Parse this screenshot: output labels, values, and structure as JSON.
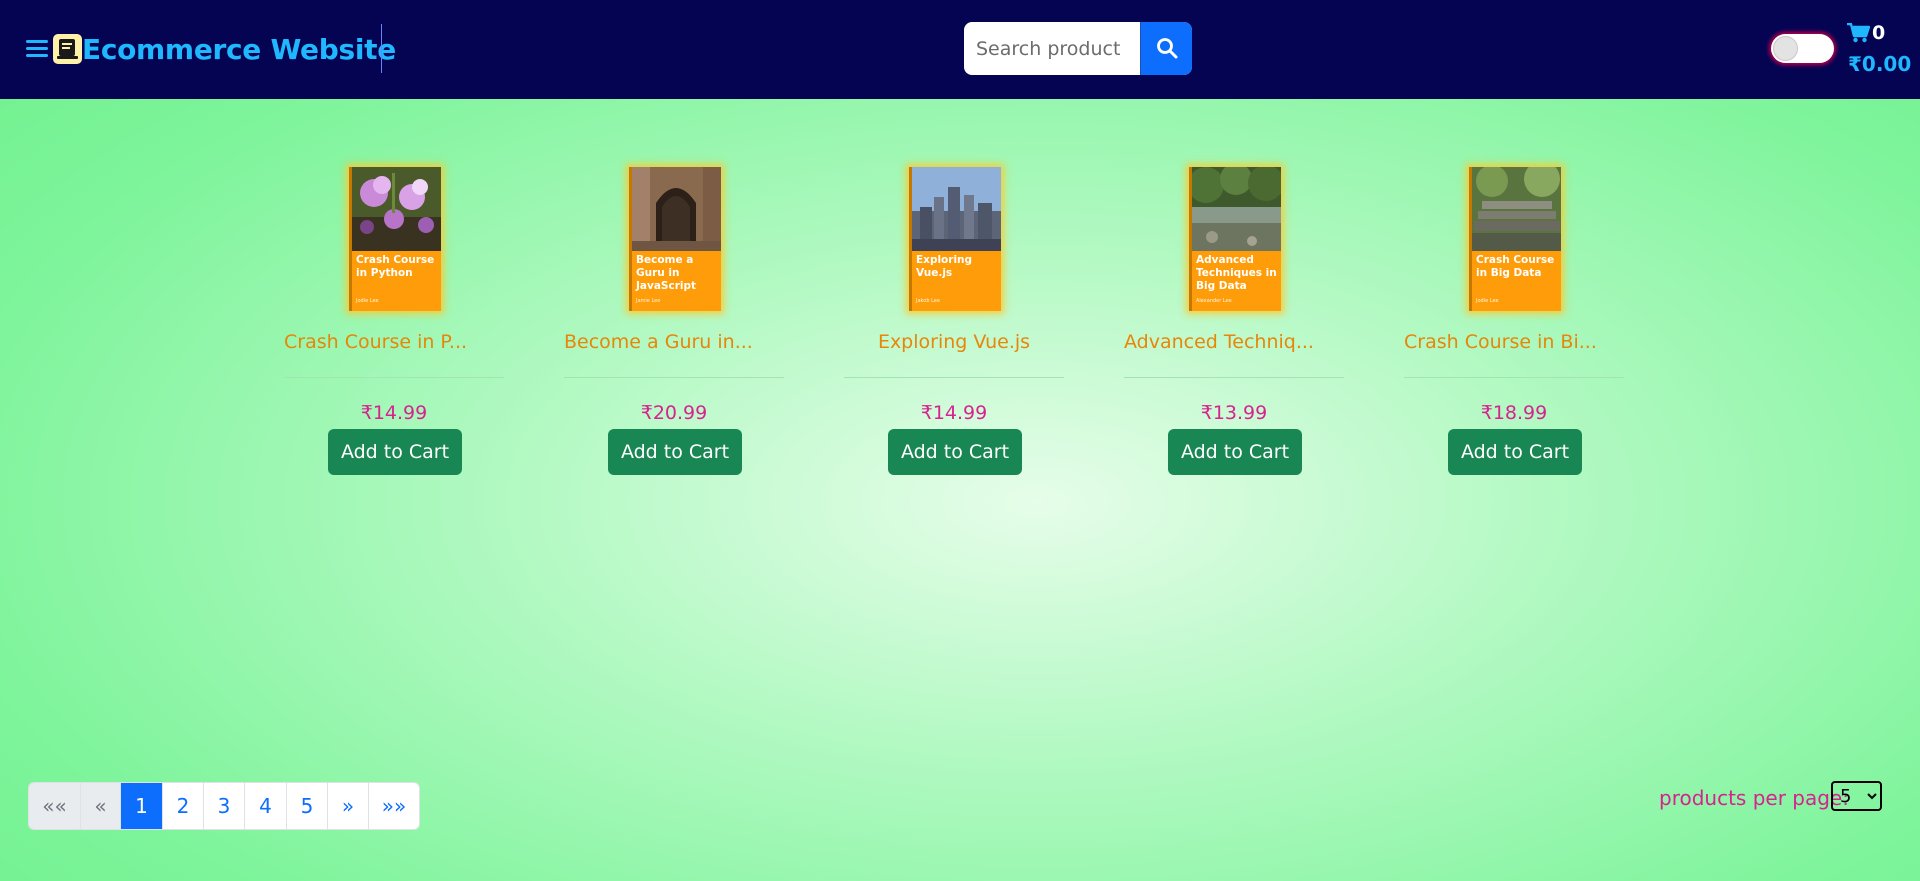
{
  "header": {
    "brand_title": "Ecommerce Website",
    "search_placeholder": "Search product",
    "cart_count": "0",
    "cart_total": "₹0.00",
    "icons": [
      "hamburger-menu-icon",
      "book-logo-icon",
      "search-icon",
      "cart-icon"
    ],
    "dark_mode_toggle": false
  },
  "products": [
    {
      "name": "Crash Course in P...",
      "cover_title": "Crash Course in Python",
      "cover_author": "Jodie Lee",
      "price": "₹14.99",
      "button_label": "Add to Cart",
      "cover_theme": "orchid-flowers"
    },
    {
      "name": "Become a Guru in...",
      "cover_title": "Become a Guru in JavaScript",
      "cover_author": "Jamie Lee",
      "price": "₹20.99",
      "button_label": "Add to Cart",
      "cover_theme": "stone-archway"
    },
    {
      "name": "Exploring Vue.js",
      "cover_title": "Exploring Vue.js",
      "cover_author": "Jakob Lee",
      "price": "₹14.99",
      "button_label": "Add to Cart",
      "cover_theme": "city-skyline"
    },
    {
      "name": "Advanced Techniq...",
      "cover_title": "Advanced Techniques in Big Data",
      "cover_author": "Alexander Lee",
      "price": "₹13.99",
      "button_label": "Add to Cart",
      "cover_theme": "forest-river"
    },
    {
      "name": "Crash Course in Bi...",
      "cover_title": "Crash Course in Big Data",
      "cover_author": "Jodie Lee",
      "price": "₹18.99",
      "button_label": "Add to Cart",
      "cover_theme": "stone-steps"
    }
  ],
  "pagination": {
    "first": "««",
    "prev": "«",
    "pages": [
      "1",
      "2",
      "3",
      "4",
      "5"
    ],
    "active_page": "1",
    "next": "»",
    "last": "»»"
  },
  "per_page": {
    "label": "products per page:",
    "selected": "5"
  },
  "colors": {
    "navbar": "#040453",
    "brand": "#1fb8ff",
    "product_name": "#e8860a",
    "price": "#d6238f",
    "add_button": "#198754",
    "page_active": "#0d6efd"
  }
}
